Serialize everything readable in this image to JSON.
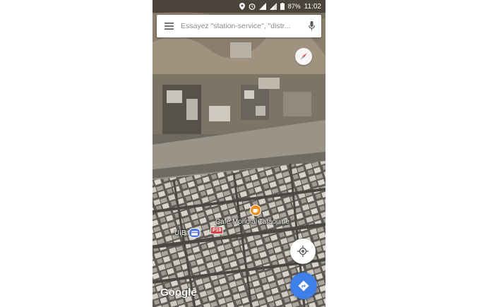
{
  "status_bar": {
    "battery_percent": "87%",
    "time": "11:02",
    "icons": [
      "location-icon",
      "alarm-icon",
      "signal-icon",
      "cellular-icon",
      "battery-icon"
    ]
  },
  "search": {
    "placeholder": "Essayez \"station-service\", \"distr..."
  },
  "map": {
    "type": "satellite",
    "pois": {
      "cafe": "Café Mondial Tataouine",
      "bank": "UIB",
      "road": "P19"
    },
    "logo": "Google"
  },
  "colors": {
    "directions_button": "#3f7fe8",
    "cafe_pin": "#ef8f21",
    "road_shield": "#d64545"
  }
}
